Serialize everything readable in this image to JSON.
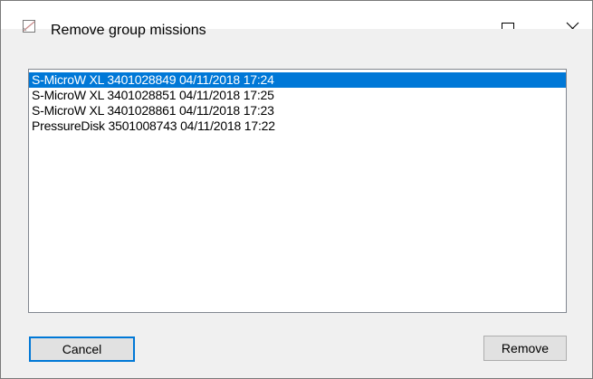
{
  "window": {
    "title": "Remove group missions",
    "icons": {
      "app": "sensor-app-icon",
      "minimize": "minimize-icon",
      "maximize": "maximize-icon",
      "close": "close-icon"
    }
  },
  "missions": {
    "items": [
      {
        "label": "S-MicroW XL 3401028849 04/11/2018 17:24",
        "selected": true
      },
      {
        "label": "S-MicroW XL 3401028851 04/11/2018 17:25",
        "selected": false
      },
      {
        "label": "S-MicroW XL 3401028861 04/11/2018 17:23",
        "selected": false
      },
      {
        "label": "PressureDisk 3501008743 04/11/2018 17:22",
        "selected": false
      }
    ]
  },
  "buttons": {
    "cancel_label": "Cancel",
    "remove_label": "Remove"
  },
  "colors": {
    "selection": "#0078d7",
    "focus_border": "#0078d7"
  }
}
